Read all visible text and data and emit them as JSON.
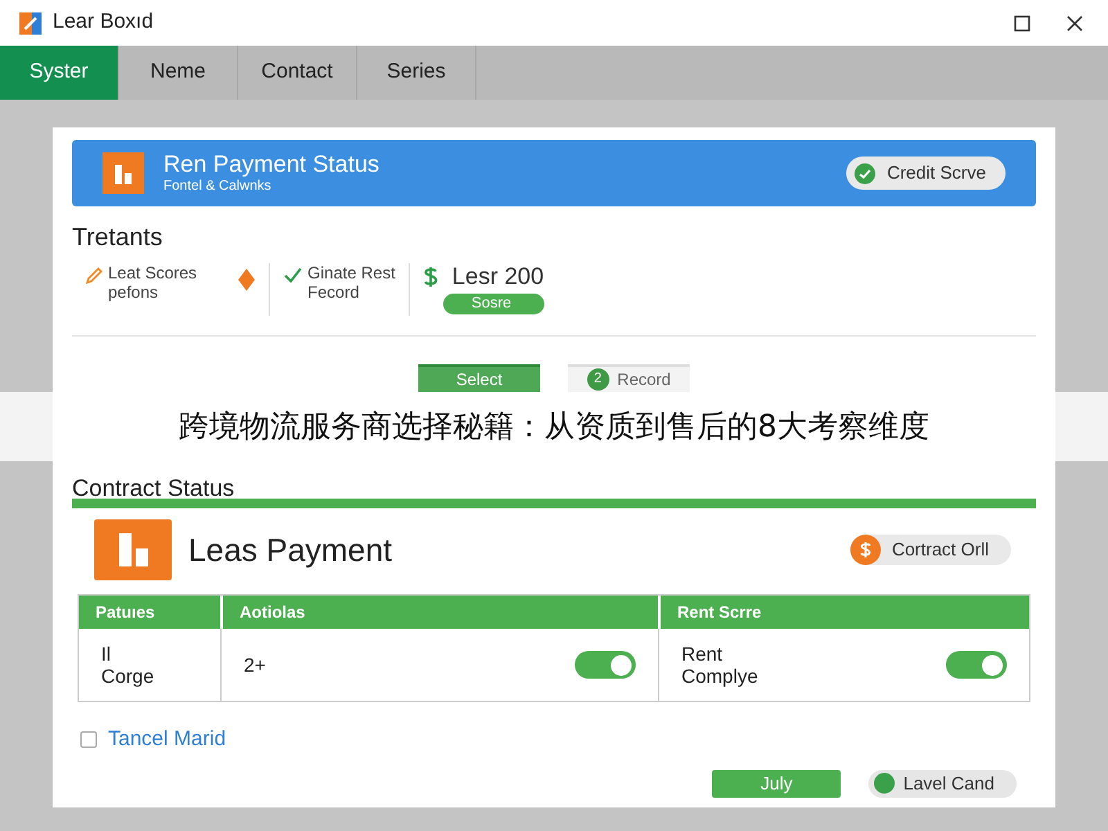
{
  "window": {
    "title": "Lear Boxıd"
  },
  "tabs": [
    {
      "label": "Syster",
      "selected": true
    },
    {
      "label": "Neme",
      "selected": false
    },
    {
      "label": "Contact",
      "selected": false
    },
    {
      "label": "Series",
      "selected": false
    }
  ],
  "header": {
    "title": "Ren Payment Status",
    "subtitle": "Fontel & Calwnks",
    "badge": "Credit Scrve"
  },
  "section_title": "Tretants",
  "items": [
    {
      "kind": "edit",
      "lines": [
        "Leat Scores",
        "pefons"
      ]
    },
    {
      "kind": "check",
      "lines": [
        "Ginate Rest",
        "Fecord"
      ]
    },
    {
      "kind": "amount",
      "lines": [
        "Lesr 200"
      ],
      "tag": "Sosre"
    }
  ],
  "step_buttons": [
    {
      "label": "Select",
      "selected": true
    },
    {
      "label": "Record",
      "selected": false,
      "number": "2"
    }
  ],
  "banner": "跨境物流服务商选择秘籍：从资质到售后的8大考察维度",
  "contract": {
    "title": "Contract Status",
    "name": "Leas Payment",
    "badge": "Cortract Orll",
    "columns": [
      "Patuıes",
      "Aotiolas",
      "Rent Scrre"
    ],
    "row": [
      {
        "lines": [
          "Il",
          "Corge"
        ]
      },
      {
        "lines": [
          "2+"
        ],
        "on": true
      },
      {
        "lines": [
          "Rent",
          "Complye"
        ],
        "on": true
      }
    ]
  },
  "checkbox": {
    "label": "Tancel Marid",
    "checked": false
  },
  "buttons": [
    {
      "kind": "primary",
      "label": "July"
    },
    {
      "kind": "pill",
      "label": "Lavel Cand"
    }
  ]
}
